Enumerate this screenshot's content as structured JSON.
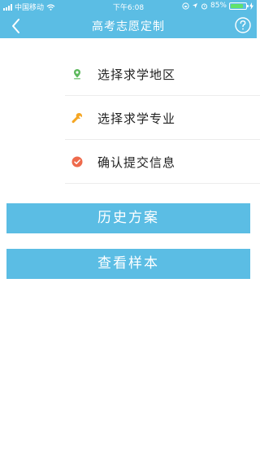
{
  "status_bar": {
    "carrier": "中国移动",
    "time": "下午6:08",
    "battery_percent": "85%",
    "battery_level": 0.85
  },
  "header": {
    "title": "高考志愿定制",
    "back_icon": "chevron-left-icon",
    "help_icon": "question-circle-icon",
    "color": "#5bbde4"
  },
  "menu": {
    "items": [
      {
        "label": "选择求学地区",
        "icon": "location-pin-icon",
        "color": "#5cb85c"
      },
      {
        "label": "选择求学专业",
        "icon": "wrench-icon",
        "color": "#f5a623"
      },
      {
        "label": "确认提交信息",
        "icon": "check-circle-icon",
        "color": "#ee6a4c"
      }
    ]
  },
  "buttons": {
    "history_label": "历史方案",
    "sample_label": "查看样本"
  }
}
